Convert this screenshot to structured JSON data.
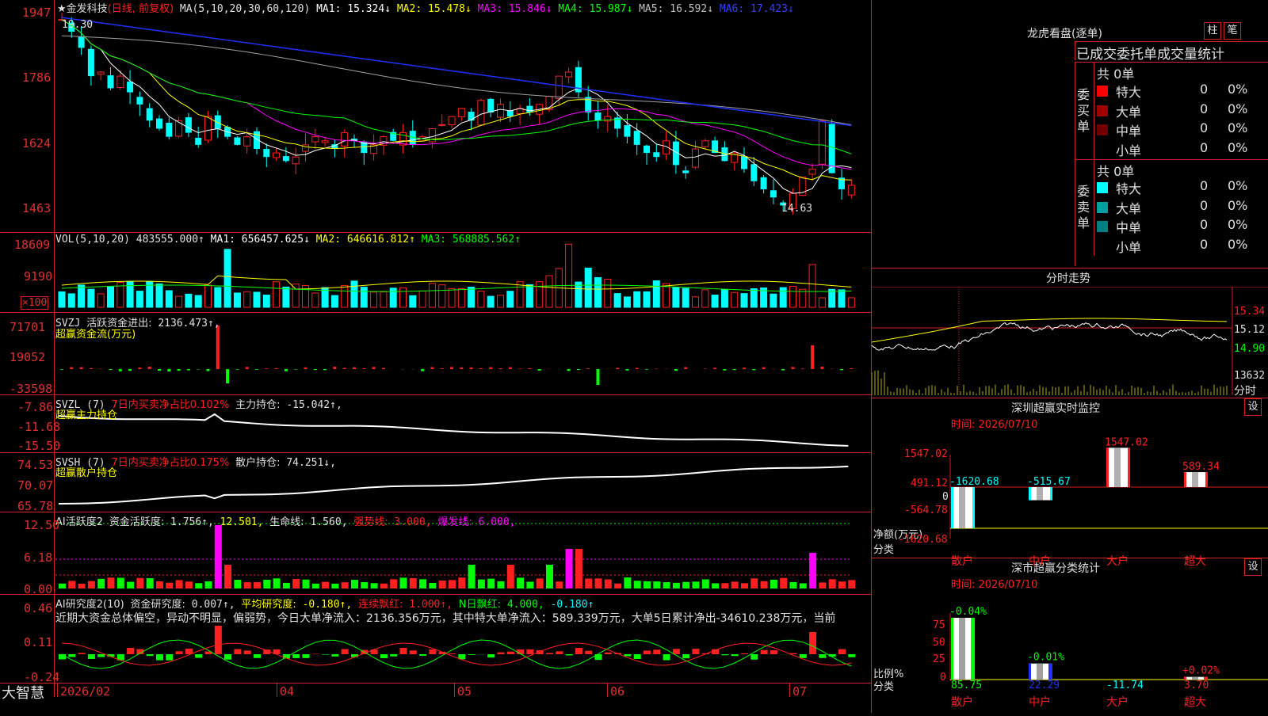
{
  "header": {
    "stock": "★金发科技",
    "mode": "(日线, 前复权)",
    "ma_prefix": "MA(5,10,20,30,60,120)",
    "ma": [
      {
        "label": "MA1:",
        "value": "15.324↓",
        "color": "#ffffff"
      },
      {
        "label": "MA2:",
        "value": "15.478↓",
        "color": "#ffff00"
      },
      {
        "label": "MA3:",
        "value": "15.846↓",
        "color": "#ff00ff"
      },
      {
        "label": "MA4:",
        "value": "15.987↓",
        "color": "#00ff00"
      },
      {
        "label": "MA5:",
        "value": "16.592↓",
        "color": "#c0c0c0"
      },
      {
        "label": "MA6:",
        "value": "17.423↓",
        "color": "#3040ff"
      }
    ]
  },
  "price_axis": [
    "1947",
    "1786",
    "1624",
    "1463"
  ],
  "price_marks": {
    "high": "19.30",
    "low": "14.63"
  },
  "colors": {
    "up": "#ff2020",
    "down": "#00ffff",
    "grid": "#d02020",
    "ma1": "#ffffff",
    "ma2": "#ffff00",
    "ma3": "#ff00ff",
    "ma4": "#00ff00",
    "ma5": "#a0a0a0",
    "ma6": "#2030ff"
  },
  "vol": {
    "title": "VOL(5,10,20)",
    "value": "483555.000↑",
    "ma": [
      {
        "label": "MA1:",
        "value": "656457.625↓",
        "color": "#ffffff"
      },
      {
        "label": "MA2:",
        "value": "646616.812↑",
        "color": "#ffff00"
      },
      {
        "label": "MA3:",
        "value": "568885.562↑",
        "color": "#00ff00"
      }
    ],
    "axis": [
      "18609",
      "9190"
    ],
    "unit": "×100"
  },
  "svzj": {
    "title": "SVZJ",
    "label": "活跃资金进出:",
    "value": "2136.473↑,",
    "subtitle": "超赢资金流(万元)",
    "axis": [
      "71701",
      "19052",
      "-33598"
    ]
  },
  "svzl": {
    "title": "SVZL (7)",
    "desc": "7日内买卖净占比0.102%",
    "label": "主力持仓:",
    "value": "-15.042↑,",
    "subtitle": "超赢主力持仓",
    "axis": [
      "-7.86",
      "-11.68",
      "-15.50"
    ]
  },
  "svsh": {
    "title": "SVSH (7)",
    "desc": "7日内买卖净占比0.175%",
    "label": "散户持仓:",
    "value": "74.251↓,",
    "subtitle": "超赢散户持仓",
    "axis": [
      "74.53",
      "70.07",
      "65.78"
    ]
  },
  "ai1": {
    "title": "AI活跃度2",
    "label": "资金活跃度:",
    "value": "1.756↑,",
    "v2": "12.501,",
    "label2": "生命线:",
    "v3": "1.560,",
    "label3": "强势线:",
    "v4": "3.000,",
    "label4": "爆发线:",
    "v5": "6.000,",
    "axis": [
      "12.50",
      "6.18",
      "0.00"
    ]
  },
  "ai2": {
    "title": "AI研究度2(10)",
    "label": "资金研究度:",
    "value": "0.007↑,",
    "label2": "平均研究度:",
    "v2": "-0.180↑,",
    "label3": "连续飘红:",
    "v3": "1.000↑,",
    "label4": "N日飘红:",
    "v4": "4.000,",
    "v5": "-0.180↑",
    "axis": [
      "0.46",
      "0.11",
      "-0.24"
    ],
    "comment": "近期大资金总体偏空，异动不明显，偏弱势，今日大单净流入：2136.356万元，其中特大单净流入：589.339万元，大单5日累计净出-34610.238万元，当前"
  },
  "xaxis": {
    "brand": "大智慧",
    "labels": [
      "2026/02",
      "04",
      "05",
      "06",
      "07"
    ]
  },
  "orderbook": {
    "title": "龙虎看盘(逐单)",
    "btn1": "柱",
    "btn2": "笔",
    "sub": "已成交委托单成交量统计",
    "buy_label": "委买单",
    "sell_label": "委卖单",
    "buy_total": "共 0单",
    "sell_total": "共 0单",
    "buy": [
      {
        "name": "特大",
        "color": "#ff0000",
        "n": "0",
        "p": "0%"
      },
      {
        "name": "大单",
        "color": "#a00000",
        "n": "0",
        "p": "0%"
      },
      {
        "name": "中单",
        "color": "#700000",
        "n": "0",
        "p": "0%"
      },
      {
        "name": "小单",
        "color": "#000000",
        "n": "0",
        "p": "0%"
      }
    ],
    "sell": [
      {
        "name": "特大",
        "color": "#00ffff",
        "n": "0",
        "p": "0%"
      },
      {
        "name": "大单",
        "color": "#00a0a0",
        "n": "0",
        "p": "0%"
      },
      {
        "name": "中单",
        "color": "#008080",
        "n": "0",
        "p": "0%"
      },
      {
        "name": "小单",
        "color": "#000000",
        "n": "0",
        "p": "0%"
      }
    ]
  },
  "intraday": {
    "title": "分时走势",
    "axis": [
      "15.34",
      "15.12",
      "14.90",
      "13632"
    ],
    "unit": "分时"
  },
  "monitor": {
    "title": "深圳超赢实时监控",
    "btn": "设",
    "time": "时间: 2026/07/10",
    "axis": [
      "1547.02",
      "491.12",
      "0",
      "-564.78",
      "-1620.68"
    ],
    "bars": [
      {
        "label": "散户",
        "value": "-1620.68"
      },
      {
        "label": "中户",
        "value": "-515.67"
      },
      {
        "label": "大户",
        "value": "1547.02"
      },
      {
        "label": "超大",
        "value": "589.34"
      }
    ],
    "ylabel": "净额(万元)",
    "xlabel": "分类"
  },
  "stat": {
    "title": "深市超赢分类统计",
    "btn": "设",
    "time": "时间: 2026/07/10",
    "axis": [
      "75",
      "50",
      "25",
      "0"
    ],
    "bars": [
      {
        "label": "散户",
        "top": "-0.04%",
        "bottom": "85.75",
        "value": 85.75
      },
      {
        "label": "中户",
        "top": "-0.01%",
        "bottom": "22.29",
        "value": 22.29
      },
      {
        "label": "大户",
        "top": "",
        "bottom": "-11.74",
        "value": 0
      },
      {
        "label": "超大",
        "top": "+0.02%",
        "bottom": "3.70",
        "value": 3.7
      }
    ],
    "ylabel": "比例%",
    "xlabel": "分类"
  }
}
